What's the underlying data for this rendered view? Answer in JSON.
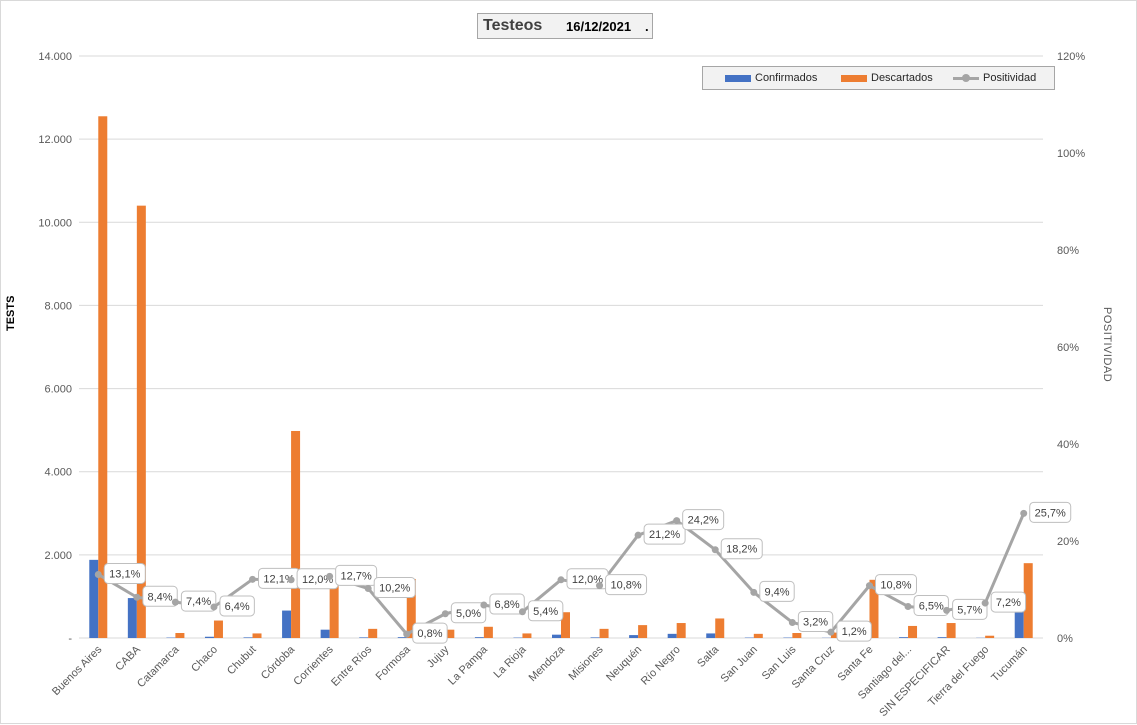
{
  "header": {
    "title": "Testeos",
    "date": "16/12/2021",
    "dot": "."
  },
  "legend": {
    "confirmados": "Confirmados",
    "descartados": "Descartados",
    "positividad": "Positividad"
  },
  "colors": {
    "confirmados": "#4472c4",
    "descartados": "#ed7d31",
    "positividad": "#a5a5a5",
    "grid": "#d9d9d9"
  },
  "chart_data": {
    "type": "bar",
    "title": "Testeos 16/12/2021 .",
    "ylabel": "TESTS",
    "y2label": "POSITIVIDAD",
    "ylim": [
      0,
      14000
    ],
    "y2lim": [
      0,
      120
    ],
    "yticks": [
      "-",
      "2.000",
      "4.000",
      "6.000",
      "8.000",
      "10.000",
      "12.000",
      "14.000"
    ],
    "y2ticks": [
      "0%",
      "20%",
      "40%",
      "60%",
      "80%",
      "100%",
      "120%"
    ],
    "categories": [
      "Buenos Aires",
      "CABA",
      "Catamarca",
      "Chaco",
      "Chubut",
      "Córdoba",
      "Corrientes",
      "Entre Ríos",
      "Formosa",
      "Jujuy",
      "La Pampa",
      "La Rioja",
      "Mendoza",
      "Misiones",
      "Neuquén",
      "Río Negro",
      "Salta",
      "San Juan",
      "San Luis",
      "Santa Cruz",
      "Santa Fe",
      "Santiago del...",
      "SIN ESPECIFICAR",
      "Tierra del Fuego",
      "Tucumán"
    ],
    "series": [
      {
        "name": "Confirmados",
        "type": "bar",
        "axis": "left",
        "values": [
          1880,
          960,
          10,
          30,
          15,
          660,
          200,
          15,
          20,
          12,
          20,
          10,
          80,
          15,
          70,
          100,
          110,
          10,
          10,
          5,
          200,
          20,
          20,
          5,
          640
        ]
      },
      {
        "name": "Descartados",
        "type": "bar",
        "axis": "left",
        "values": [
          12550,
          10400,
          120,
          420,
          110,
          4980,
          1300,
          220,
          1420,
          200,
          270,
          110,
          620,
          220,
          310,
          360,
          470,
          100,
          120,
          130,
          1400,
          290,
          360,
          55,
          1800
        ]
      },
      {
        "name": "Positividad",
        "type": "line",
        "axis": "right",
        "values": [
          13.1,
          8.4,
          7.4,
          6.4,
          12.1,
          12.0,
          12.7,
          10.2,
          0.8,
          5.0,
          6.8,
          5.4,
          12.0,
          10.8,
          21.2,
          24.2,
          18.2,
          9.4,
          3.2,
          1.2,
          10.8,
          6.5,
          5.7,
          7.2,
          25.7
        ],
        "labels": [
          "13,1%",
          "8,4%",
          "7,4%",
          "6,4%",
          "12,1%",
          "12,0%",
          "12,7%",
          "10,2%",
          "0,8%",
          "5,0%",
          "6,8%",
          "5,4%",
          "12,0%",
          "10,8%",
          "21,2%",
          "24,2%",
          "18,2%",
          "9,4%",
          "3,2%",
          "1,2%",
          "10,8%",
          "6,5%",
          "5,7%",
          "7,2%",
          "25,7%"
        ]
      }
    ],
    "grid": true,
    "legend_position": "top-right"
  }
}
